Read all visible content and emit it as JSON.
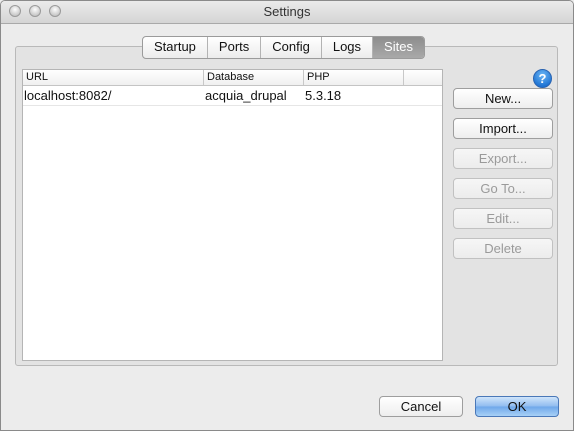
{
  "window": {
    "title": "Settings"
  },
  "tabs": [
    {
      "label": "Startup",
      "active": false
    },
    {
      "label": "Ports",
      "active": false
    },
    {
      "label": "Config",
      "active": false
    },
    {
      "label": "Logs",
      "active": false
    },
    {
      "label": "Sites",
      "active": true
    }
  ],
  "sites_table": {
    "columns": [
      "URL",
      "Database",
      "PHP",
      ""
    ],
    "rows": [
      {
        "url": "localhost:8082/",
        "database": "acquia_drupal",
        "php": "5.3.18"
      }
    ]
  },
  "help": {
    "glyph": "?",
    "icon": "help-icon"
  },
  "side_buttons": {
    "new": {
      "label": "New...",
      "enabled": true
    },
    "import": {
      "label": "Import...",
      "enabled": true
    },
    "export": {
      "label": "Export...",
      "enabled": false
    },
    "goto": {
      "label": "Go To...",
      "enabled": false
    },
    "edit": {
      "label": "Edit...",
      "enabled": false
    },
    "delete": {
      "label": "Delete",
      "enabled": false
    }
  },
  "dialog_buttons": {
    "cancel": "Cancel",
    "ok": "OK"
  },
  "colors": {
    "accent": "#6ea7ea",
    "active_tab": "#9a9a9a",
    "help": "#1e73d3"
  }
}
